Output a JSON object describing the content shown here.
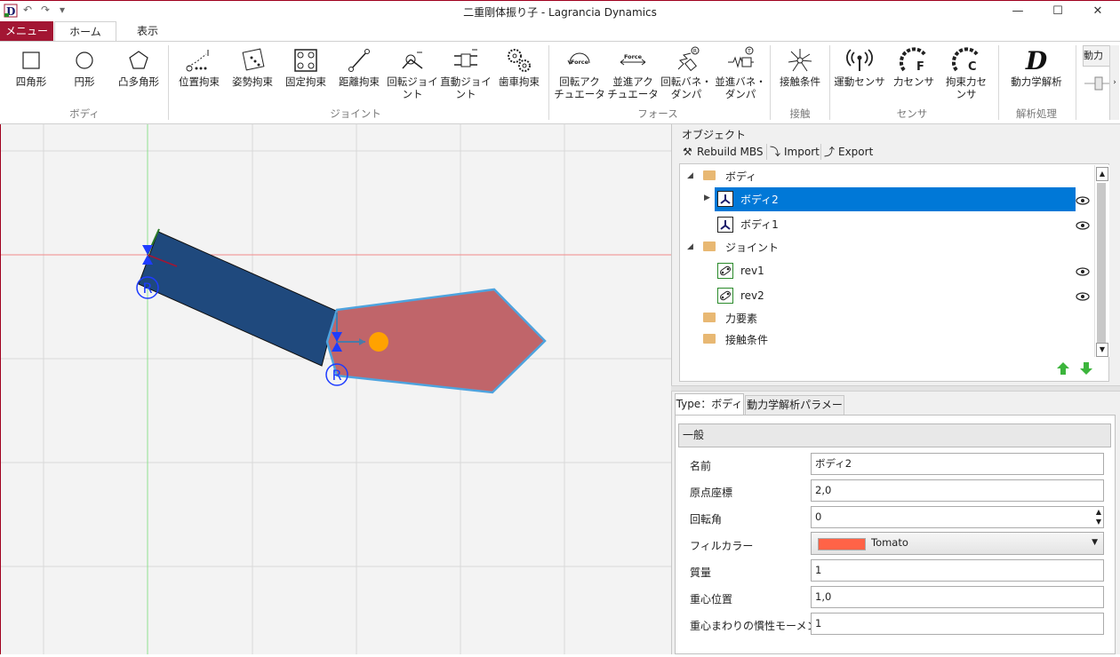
{
  "window": {
    "title": "二重剛体振り子 - Lagrancia Dynamics",
    "minimize": "—",
    "maximize": "☐",
    "close": "✕"
  },
  "tabs": {
    "menu": "メニュー",
    "home": "ホーム",
    "view": "表示"
  },
  "ribbon": {
    "body_group": "ボディ",
    "joint_group": "ジョイント",
    "force_group": "フォース",
    "contact_group": "接触",
    "sensor_group": "センサ",
    "analysis_group": "解析処理",
    "rectangle": "四角形",
    "circle": "円形",
    "polygon": "凸多角形",
    "pos_constraint": "位置拘束",
    "att_constraint": "姿勢拘束",
    "fixed_constraint": "固定拘束",
    "dist_constraint": "距離拘束",
    "rev_joint_1": "回転ジョイ",
    "rev_joint_2": "ント",
    "lin_joint_1": "直動ジョイ",
    "lin_joint_2": "ント",
    "gear_constraint": "歯車拘束",
    "rot_act_1": "回転アク",
    "rot_act_2": "チュエータ",
    "lin_act_1": "並進アク",
    "lin_act_2": "チュエータ",
    "rot_spring_1": "回転バネ・",
    "rot_spring_2": "ダンパ",
    "lin_spring_1": "並進バネ・",
    "lin_spring_2": "ダンパ",
    "contact_cond": "接触条件",
    "motion_sensor": "運動センサ",
    "force_sensor": "力センサ",
    "constraint_force_1": "拘束力セ",
    "constraint_force_2": "ンサ",
    "dynamics": "動力学解析",
    "partial": "動力",
    "force_icon_text": "Force",
    "f_letter": "F",
    "c_letter": "C",
    "d_letter": "D",
    "r_mark": "R",
    "t_mark": "T"
  },
  "panel": {
    "objects_title": "オブジェクト",
    "rebuild": "Rebuild MBS",
    "import": "Import",
    "export": "Export",
    "tree": {
      "body_folder": "ボディ",
      "body2": "ボディ2",
      "body1": "ボディ1",
      "joint_folder": "ジョイント",
      "rev1": "rev1",
      "rev2": "rev2",
      "force_folder": "力要素",
      "contact_folder": "接触条件"
    },
    "prop_tabs": {
      "type": "Type：ボディ",
      "params": "動力学解析パラメータ"
    },
    "section": "一般",
    "props": {
      "name_label": "名前",
      "name_value": "ボディ2",
      "origin_label": "原点座標",
      "origin_value": "2,0",
      "rotation_label": "回転角",
      "rotation_value": "0",
      "fill_label": "フィルカラー",
      "fill_value": "Tomato",
      "mass_label": "質量",
      "mass_value": "1",
      "cog_label": "重心位置",
      "cog_value": "1,0",
      "inertia_label": "重心まわりの慣性モーメント",
      "inertia_value": "1"
    }
  },
  "canvas": {
    "joint_label_1": "R",
    "joint_label_2": "R"
  },
  "colors": {
    "accent": "#a31633",
    "body1": "#1f497d",
    "body2": "#c0656a",
    "selection": "#0078d7",
    "tomato": "#ff6347"
  }
}
